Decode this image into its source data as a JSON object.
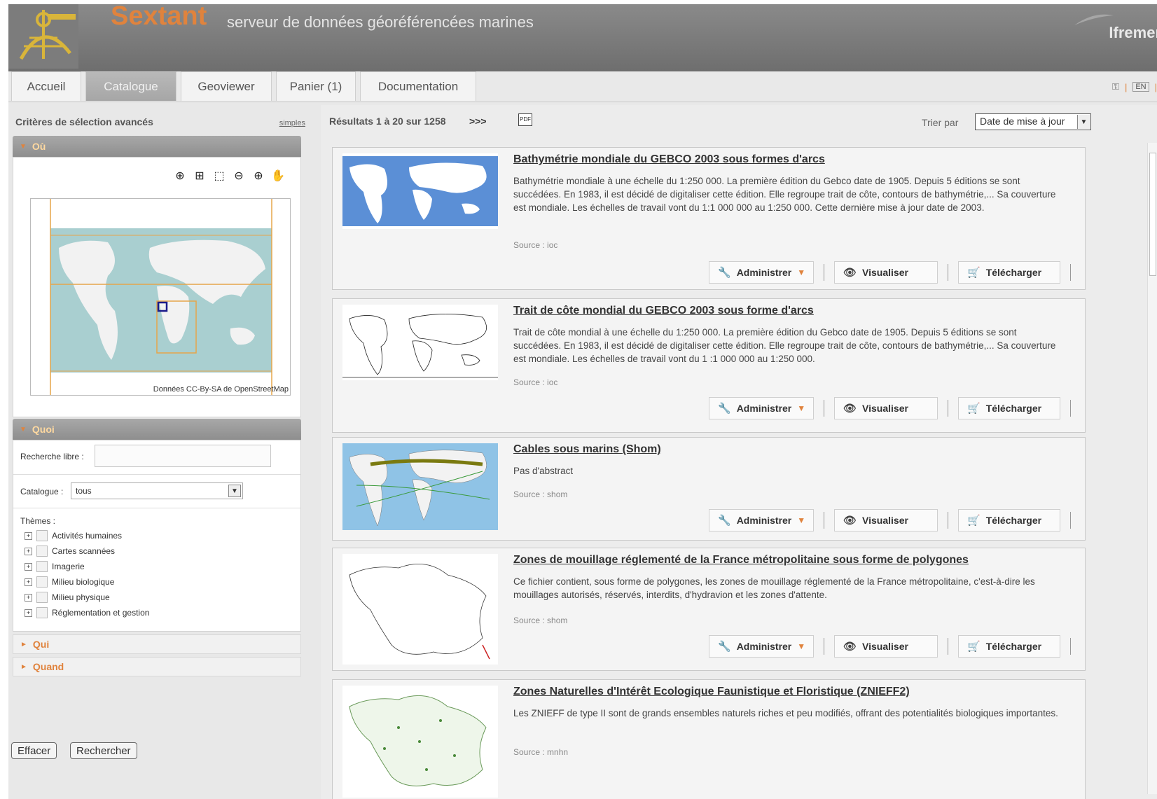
{
  "header": {
    "brand": "Sextant",
    "tagline": "serveur de données géoréférencées marines",
    "partner": "Ifremer"
  },
  "tabs": [
    {
      "label": "Accueil"
    },
    {
      "label": "Catalogue"
    },
    {
      "label": "Geoviewer"
    },
    {
      "label": "Panier (1)"
    },
    {
      "label": "Documentation"
    }
  ],
  "top_right": {
    "lang": "EN"
  },
  "left": {
    "title": "Critères de sélection avancés",
    "simples_link": "simples",
    "where": {
      "label": "Où",
      "map_attribution": "Données CC-By-SA de OpenStreetMap"
    },
    "what": {
      "label": "Quoi",
      "free_search_label": "Recherche libre :",
      "free_search_value": "",
      "catalogue_label": "Catalogue :",
      "catalogue_value": "tous",
      "themes_label": "Thèmes :",
      "themes": [
        {
          "label": "Activités humaines"
        },
        {
          "label": "Cartes scannées"
        },
        {
          "label": "Imagerie"
        },
        {
          "label": "Milieu biologique"
        },
        {
          "label": "Milieu physique"
        },
        {
          "label": "Réglementation et gestion"
        }
      ]
    },
    "who": {
      "label": "Qui"
    },
    "when": {
      "label": "Quand"
    },
    "buttons": {
      "clear": "Effacer",
      "search": "Rechercher"
    }
  },
  "results": {
    "count_text": "Résultats 1 à 20 sur 1258",
    "next": ">>>",
    "pdf": "PDF",
    "sort_label": "Trier par",
    "sort_value": "Date de mise à jour",
    "actions": {
      "admin": "Administrer",
      "view": "Visualiser",
      "download": "Télécharger"
    },
    "items": [
      {
        "title": "Bathymétrie mondiale du GEBCO 2003 sous formes d'arcs",
        "abstract": "Bathymétrie mondiale à une échelle du 1:250 000. La première édition du Gebco date de 1905. Depuis 5 éditions se sont succédées. En 1983, il est décidé de digitaliser cette édition. Elle regroupe trait de côte, contours de bathymétrie,... Sa couverture est mondiale. Les échelles de travail vont du 1:1 000 000 au 1:250 000. Cette dernière mise à jour date de 2003.",
        "source": "Source : ioc"
      },
      {
        "title": "Trait de côte mondial du GEBCO 2003 sous forme d'arcs",
        "abstract": "Trait de côte mondial à une échelle du 1:250 000. La première édition du Gebco date de 1905. Depuis 5 éditions se sont succédées. En 1983, il est décidé de digitaliser cette édition. Elle regroupe trait de côte, contours de bathymétrie,... Sa couverture est mondiale. Les échelles de travail vont du 1 :1 000 000 au 1:250 000.",
        "source": "Source : ioc"
      },
      {
        "title": "Cables sous marins (Shom)",
        "abstract": "Pas d'abstract",
        "source": "Source : shom"
      },
      {
        "title": "Zones de mouillage réglementé de la France métropolitaine sous forme de polygones",
        "abstract": "Ce fichier contient, sous forme de polygones, les zones de mouillage réglementé de la France métropolitaine, c'est-à-dire les mouillages autorisés, réservés, interdits, d'hydravion et les zones d'attente.",
        "source": "Source : shom"
      },
      {
        "title": "Zones Naturelles d'Intérêt Ecologique Faunistique et Floristique (ZNIEFF2)",
        "abstract": "Les ZNIEFF de type II sont de grands ensembles naturels riches et peu modifiés, offrant des potentialités biologiques importantes.",
        "source": "Source : mnhn"
      }
    ]
  },
  "colors": {
    "accent": "#e0833d",
    "header": "#7b7b7b",
    "active_tab": "#b0b0b0"
  },
  "icons": [
    "sextant-logo",
    "key-icon",
    "globe-icon",
    "grid-icon",
    "select-icon",
    "zoom-out-icon",
    "zoom-in-icon",
    "pan-hand-icon",
    "pdf-icon",
    "wrench-icon",
    "eye-icon",
    "cart-icon"
  ]
}
